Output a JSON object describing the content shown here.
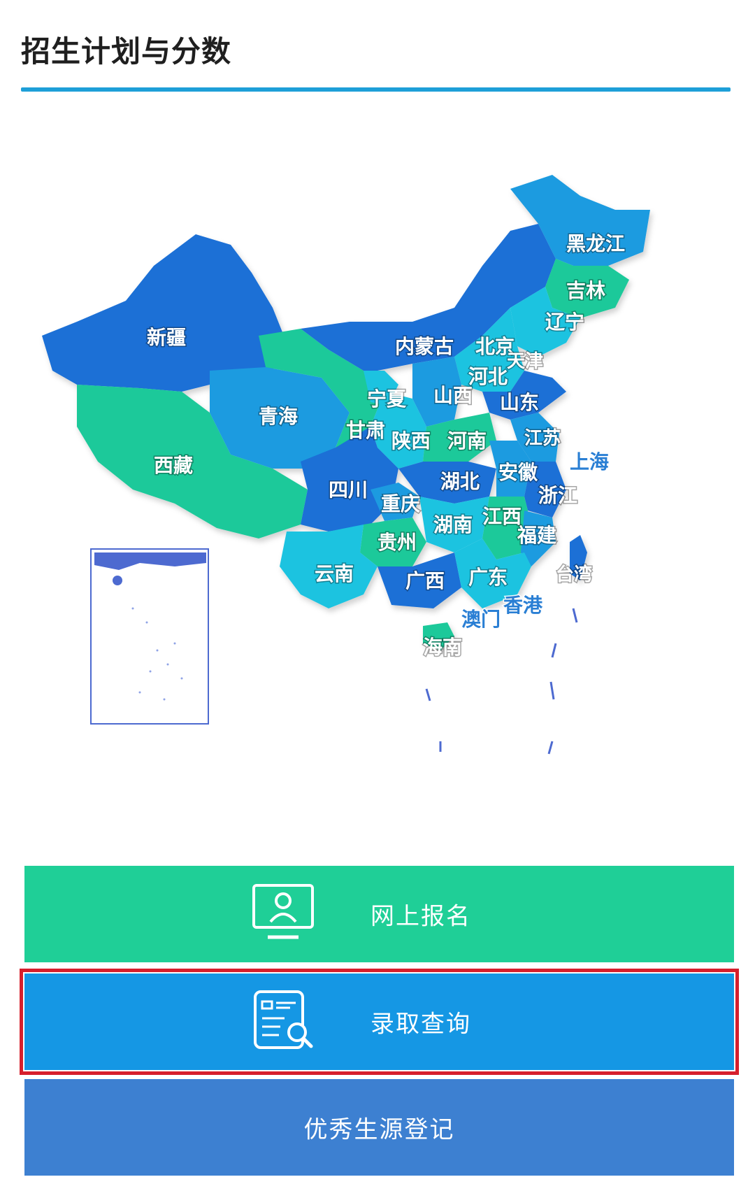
{
  "header": {
    "title": "招生计划与分数"
  },
  "map": {
    "provinces": [
      "黑龙江",
      "吉林",
      "辽宁",
      "内蒙古",
      "北京",
      "天津",
      "河北",
      "新疆",
      "宁夏",
      "山西",
      "山东",
      "青海",
      "甘肃",
      "陕西",
      "河南",
      "江苏",
      "西藏",
      "上海",
      "安徽",
      "四川",
      "湖北",
      "浙江",
      "重庆",
      "湖南",
      "江西",
      "贵州",
      "福建",
      "台湾",
      "云南",
      "广西",
      "广东",
      "香港",
      "澳门",
      "海南"
    ],
    "colors": {
      "dark_blue": "#1a6fd6",
      "mid_blue": "#1d9be0",
      "cyan": "#1dc3e0",
      "green": "#1ec99a"
    }
  },
  "actions": {
    "register_label": "网上报名",
    "query_label": "录取查询",
    "excellent_label": "优秀生源登记"
  },
  "icons": {
    "register": "monitor-user-icon",
    "query": "document-search-icon"
  },
  "colors": {
    "accent_rule": "#1e9fd8",
    "register_bg": "#1fcf97",
    "query_bg": "#1597e4",
    "excellent_bg": "#3d80d1",
    "highlight_border": "#d61f2c"
  }
}
